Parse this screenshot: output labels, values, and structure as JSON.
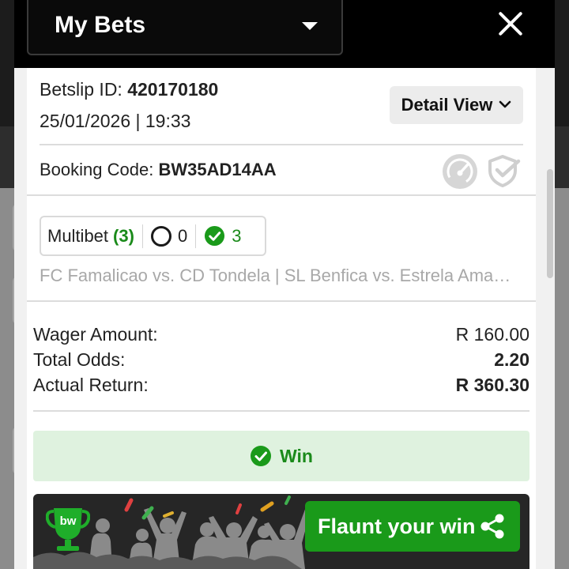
{
  "header": {
    "title": "My Bets",
    "close_label": "Close"
  },
  "betslip": {
    "id_label": "Betslip ID:",
    "id_value": "420170180",
    "datetime": "25/01/2026 | 19:33",
    "detail_view_label": "Detail View",
    "booking_label": "Booking Code:",
    "booking_value": "BW35AD14AA"
  },
  "bet_type": {
    "label": "Multibet",
    "count": "(3)",
    "open_count": "0",
    "won_count": "3"
  },
  "matches_text": "FC Famalicao vs. CD Tondela | SL Benfica vs. Estrela Amadora",
  "summary": [
    {
      "label": "Wager Amount:",
      "value": "R 160.00",
      "bold": false
    },
    {
      "label": "Total Odds:",
      "value": "2.20",
      "bold": true
    },
    {
      "label": "Actual Return:",
      "value": "R 360.30",
      "bold": true
    }
  ],
  "result": {
    "label": "Win"
  },
  "flaunt": {
    "label": "Flaunt your win",
    "logo_text": "bw"
  },
  "colors": {
    "accent_green": "#1a9a1a",
    "win_bg": "#dff2df",
    "header_bg": "#000000"
  },
  "icons": [
    "chevron-down-icon",
    "close-icon",
    "gauge-icon",
    "shield-check-icon",
    "circle-open-icon",
    "check-circle-icon",
    "trophy-icon",
    "share-icon"
  ]
}
